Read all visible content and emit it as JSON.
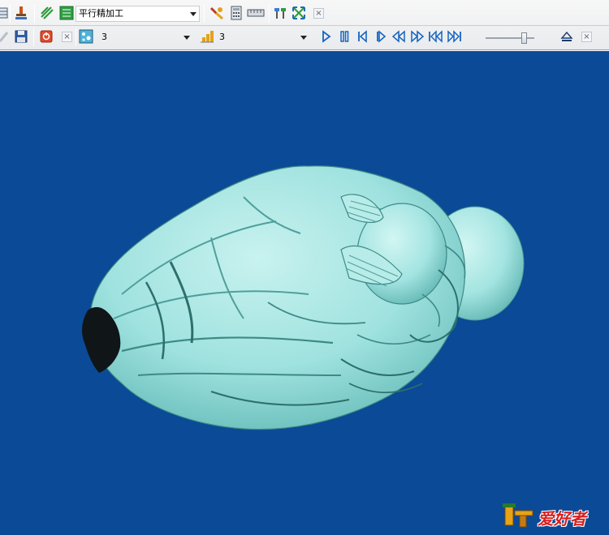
{
  "toolbar_top": {
    "strategy_combo": {
      "value": "平行精加工"
    }
  },
  "toolbar_bottom": {
    "combo_a": {
      "value": "3"
    },
    "combo_b": {
      "value": "3"
    },
    "slider": {
      "value": 0.8
    }
  },
  "icons": {
    "play": "play-icon",
    "pause": "pause-icon",
    "step_back": "step-back-icon",
    "step_forward": "step-forward-icon",
    "rewind": "rewind-icon",
    "fast_forward": "fast-forward-icon",
    "skip_start": "skip-to-start-icon",
    "skip_end": "skip-to-end-icon",
    "eject": "eject-icon"
  },
  "colors": {
    "viewport_bg": "#0b4a96",
    "model_surface": "#9fe2df",
    "playback_blue": "#1565c0"
  },
  "watermark": {
    "text": "爱好者"
  }
}
